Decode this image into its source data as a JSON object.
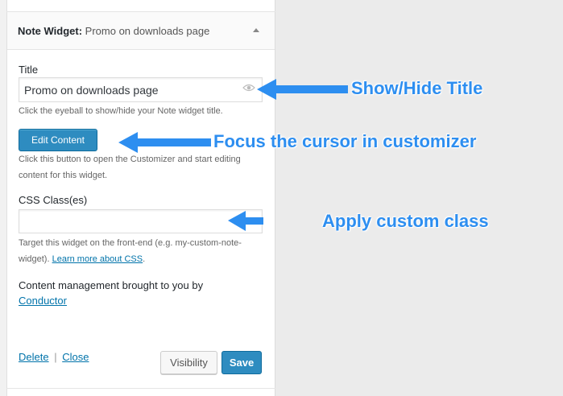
{
  "widget": {
    "header_prefix": "Note Widget:",
    "header_title": "Promo on downloads page"
  },
  "title_field": {
    "label": "Title",
    "value": "Promo on downloads page",
    "help": "Click the eyeball to show/hide your Note widget title."
  },
  "edit_content": {
    "button_label": "Edit Content",
    "help": "Click this button to open the Customizer and start editing content for this widget."
  },
  "css_field": {
    "label": "CSS Class(es)",
    "value": "",
    "help_prefix": "Target this widget on the front-end (e.g. my-custom-note-widget).",
    "help_link": "Learn more about CSS",
    "help_suffix": "."
  },
  "credit": {
    "text": "Content management brought to you by",
    "link": "Conductor"
  },
  "footer": {
    "delete_label": "Delete",
    "separator": "|",
    "close_label": "Close",
    "visibility_label": "Visibility",
    "save_label": "Save"
  },
  "annotations": {
    "show_hide": "Show/Hide Title",
    "focus": "Focus the cursor in customizer",
    "apply_class": "Apply custom class"
  },
  "colors": {
    "annotation": "#2d8ef0",
    "primary_button": "#2e8cc0",
    "link": "#0073aa"
  },
  "icons": {
    "eye": "eye-icon",
    "toggle": "arrow-up-icon"
  }
}
